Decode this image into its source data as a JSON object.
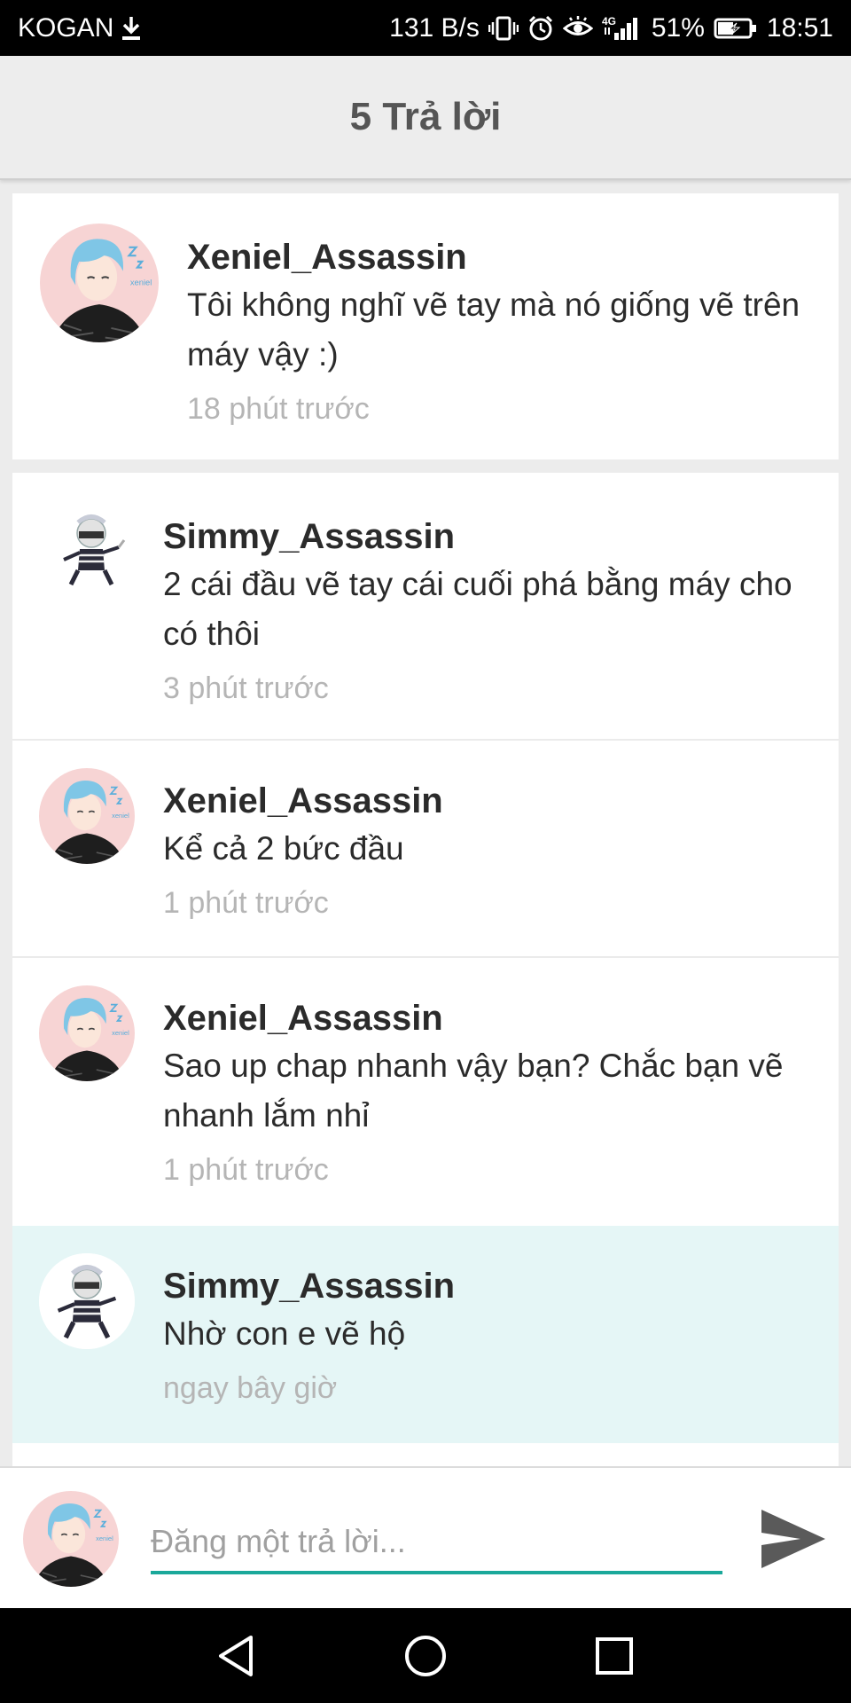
{
  "status_bar": {
    "carrier": "KOGAN",
    "download_icon": "download-arrow-icon",
    "network_speed": "131 B/s",
    "icons": [
      "vibrate-icon",
      "alarm-icon",
      "eye-icon",
      "4g-signal-icon"
    ],
    "network_type": "4G",
    "battery_percent": "51%",
    "battery_level": 0.51,
    "time": "18:51"
  },
  "header": {
    "title": "5 Trả lời"
  },
  "top_comment": {
    "username": "Xeniel_Assassin",
    "text": "Tôi không nghĩ vẽ tay mà nó giống vẽ trên máy vậy :)",
    "time": "18 phút trước",
    "avatar_icon": "xeniel-avatar"
  },
  "replies": [
    {
      "username": "Simmy_Assassin",
      "text": "2 cái đầu vẽ tay cái cuối phá bằng máy cho có thôi",
      "time": "3 phút trước",
      "avatar_icon": "simmy-avatar"
    },
    {
      "username": "Xeniel_Assassin",
      "text": "Kể cả 2 bức đầu",
      "time": "1 phút trước",
      "avatar_icon": "xeniel-avatar"
    },
    {
      "username": "Xeniel_Assassin",
      "text": "Sao up chap nhanh vậy bạn? Chắc bạn vẽ nhanh lắm nhỉ",
      "time": "1 phút trước",
      "avatar_icon": "xeniel-avatar"
    },
    {
      "username": "Simmy_Assassin",
      "text": "Nhờ con e vẽ hộ",
      "time": "ngay bây giờ",
      "avatar_icon": "simmy-avatar"
    }
  ],
  "composer": {
    "placeholder": "Đăng một trả lời...",
    "value": "",
    "send_icon": "send-icon",
    "accent_color": "#1aa89a"
  },
  "nav_bar": {
    "buttons": [
      "back-triangle-icon",
      "home-circle-icon",
      "recents-square-icon"
    ]
  },
  "colors": {
    "highlight_background": "#e5f6f6",
    "timestamp_gray": "#b5b5b5",
    "header_background": "#ededed"
  }
}
